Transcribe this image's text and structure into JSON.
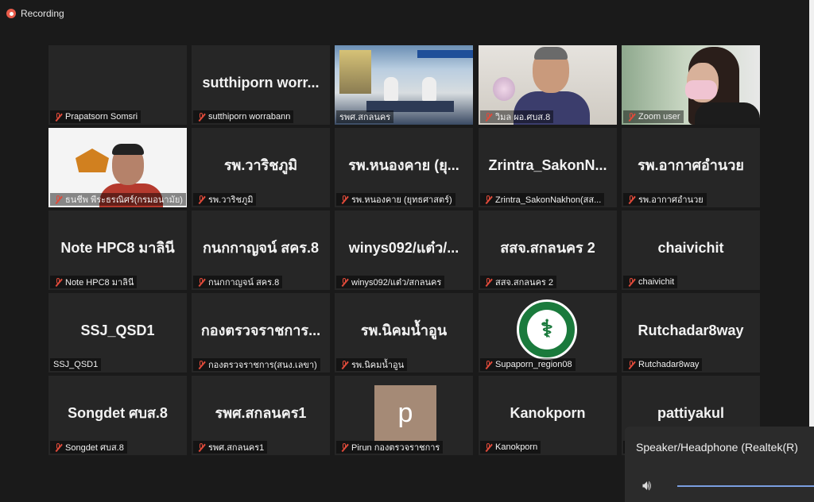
{
  "recording_label": "Recording",
  "tiles": [
    {
      "name": "Prapatsorn Somsri",
      "big": "",
      "muted": true
    },
    {
      "name": "sutthiporn worrabann",
      "big": "sutthiporn worr...",
      "muted": true
    },
    {
      "name": "รพศ.สกลนคร",
      "big": "",
      "muted": false,
      "active": true,
      "video": "room"
    },
    {
      "name": "วิมล ผอ.ศบส.8",
      "big": "",
      "muted": true,
      "video": "man"
    },
    {
      "name": "Zoom user",
      "big": "",
      "muted": true,
      "video": "woman"
    },
    {
      "name": "ธนชีพ พีระธรณิศร์(กรมอนามัย)",
      "big": "",
      "muted": true,
      "video": "speaker"
    },
    {
      "name": "รพ.วาริชภูมิ",
      "big": "รพ.วาริชภูมิ",
      "muted": true
    },
    {
      "name": "รพ.หนองคาย (ยุทธศาสตร์)",
      "big": "รพ.หนองคาย (ยุ...",
      "muted": true
    },
    {
      "name": "Zrintra_SakonNakhon(สส...",
      "big": "Zrintra_SakonN...",
      "muted": true
    },
    {
      "name": "รพ.อากาศอำนวย",
      "big": "รพ.อากาศอำนวย",
      "muted": true
    },
    {
      "name": "Note HPC8 มาลินี",
      "big": "Note  HPC8 มาลินี",
      "muted": true
    },
    {
      "name": "กนกกาญจน์ สคร.8",
      "big": "กนกกาญจน์ สคร.8",
      "muted": true
    },
    {
      "name": "winys092/แต๋ว/สกลนคร",
      "big": "winys092/แต๋ว/...",
      "muted": true
    },
    {
      "name": "สสจ.สกลนคร 2",
      "big": "สสจ.สกลนคร 2",
      "muted": true
    },
    {
      "name": "chaivichit",
      "big": "chaivichit",
      "muted": true
    },
    {
      "name": "SSJ_QSD1",
      "big": "SSJ_QSD1",
      "muted": false
    },
    {
      "name": "กองตรวจราชการ(สนง.เลขา)",
      "big": "กองตรวจราชการ...",
      "muted": true
    },
    {
      "name": "รพ.นิคมน้ำอูน",
      "big": "รพ.นิคมน้ำอูน",
      "muted": true
    },
    {
      "name": "Supaporn_region08",
      "big": "",
      "muted": true,
      "video": "logo"
    },
    {
      "name": "Rutchadar8way",
      "big": "Rutchadar8way",
      "muted": true
    },
    {
      "name": "Songdet ศบส.8",
      "big": "Songdet ศบส.8",
      "muted": true
    },
    {
      "name": "รพศ.สกลนคร1",
      "big": "รพศ.สกลนคร1",
      "muted": true
    },
    {
      "name": "Pirun กองตรวจราชการ",
      "big": "",
      "muted": true,
      "video": "avatar",
      "avatar_letter": "p"
    },
    {
      "name": "Kanokporn",
      "big": "Kanokporn",
      "muted": true
    },
    {
      "name": "pattiyakul",
      "big": "pattiyakul",
      "muted": true
    }
  ],
  "audio_popup": {
    "title": "Speaker/Headphone (Realtek(R)",
    "icon": "speaker-volume-icon"
  },
  "colors": {
    "active_border": "#d9e46a",
    "muted_icon": "#e04a3a",
    "background": "#1a1a1a"
  }
}
